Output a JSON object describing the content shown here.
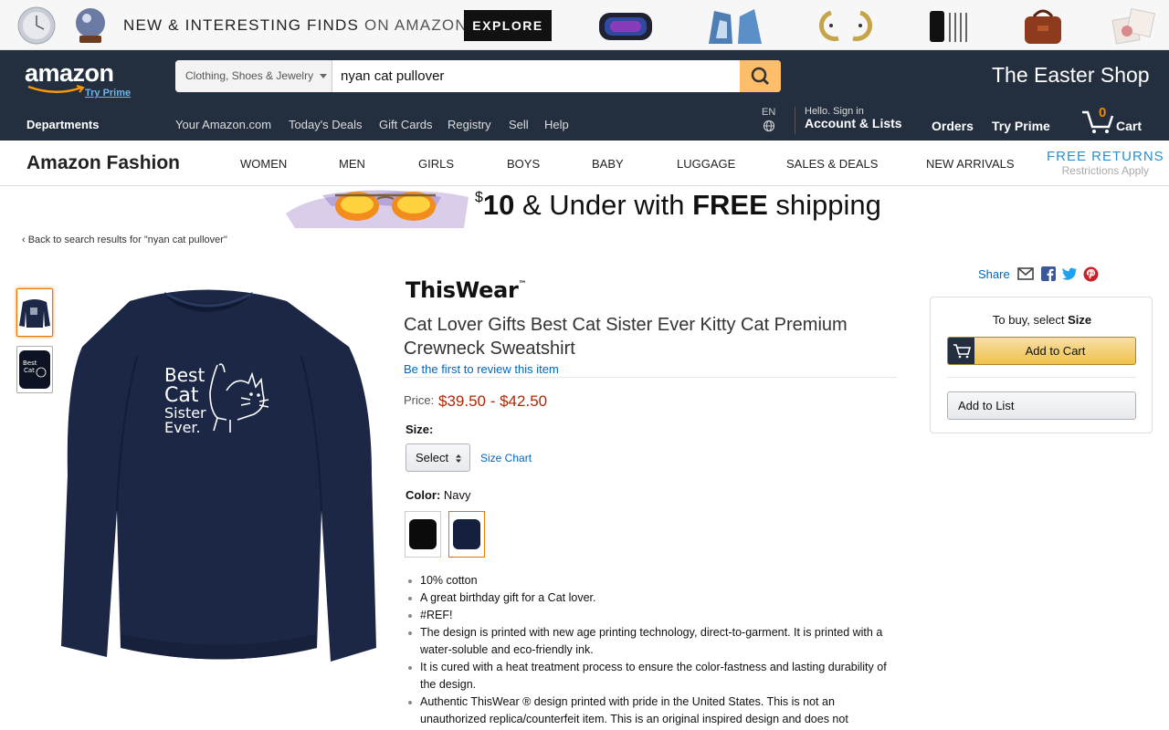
{
  "promo": {
    "tagline_bold": "NEW & INTERESTING FINDS",
    "tagline_light": "ON AMAZON",
    "explore_label": "EXPLORE"
  },
  "nav": {
    "logo_word": "amazon",
    "try_prime_link": "Try Prime",
    "search_category": "Clothing, Shoes & Jewelry",
    "search_value": "nyan cat pullover",
    "shop_banner": "The Easter Shop",
    "departments": "Departments",
    "links": [
      "Your Amazon.com",
      "Today's Deals",
      "Gift Cards",
      "Registry",
      "Sell",
      "Help"
    ],
    "lang": "EN",
    "hello": "Hello. Sign in",
    "account": "Account & Lists",
    "orders": "Orders",
    "try_prime": "Try Prime",
    "cart_count": "0",
    "cart_label": "Cart"
  },
  "fashion": {
    "brand": "Amazon Fashion",
    "links": [
      "WOMEN",
      "MEN",
      "GIRLS",
      "BOYS",
      "BABY",
      "LUGGAGE",
      "SALES & DEALS",
      "NEW ARRIVALS"
    ],
    "free_returns": "FREE RETURNS",
    "restrictions": "Restrictions Apply"
  },
  "deal_banner": {
    "dollar": "$",
    "amount": "10",
    "middle": " & Under with ",
    "free": "FREE",
    "shipping": " shipping"
  },
  "breadcrumb": "‹  Back to search results for \"nyan cat pullover\"",
  "product": {
    "brand_logo": "ThisWear",
    "brand_tm": "™",
    "title": "Cat Lover Gifts Best Cat Sister Ever Kitty Cat Premium Crewneck Sweatshirt",
    "review_link": "Be the first to review this item",
    "price_label": "Price:",
    "price_value": "$39.50 - $42.50",
    "size_label": "Size:",
    "size_select": "Select",
    "size_chart": "Size Chart",
    "color_label": "Color:",
    "color_value": "Navy",
    "bullets": [
      "10% cotton",
      "A great birthday gift for a Cat lover.",
      "#REF!",
      "The design is printed with new age printing technology, direct-to-garment. It is printed with a water-soluble and eco-friendly ink.",
      "It is cured with a heat treatment process to ensure the color-fastness and lasting durability of the design.",
      "Authentic ThisWear ® design printed with pride in the United States. This is not an unauthorized replica/counterfeit item. This is an original inspired design and does not"
    ],
    "print_lines": [
      "Best",
      "Cat",
      "Sister",
      "Ever."
    ]
  },
  "buybox": {
    "share": "Share",
    "hint_prefix": "To buy, select ",
    "hint_bold": "Size",
    "add_to_cart": "Add to Cart",
    "add_to_list": "Add to List"
  },
  "colors": {
    "nav_bg": "#232f3e",
    "price": "#b12704",
    "link": "#0066c0",
    "cart_btn": "#f0c14b",
    "navy": "#1b2745"
  }
}
